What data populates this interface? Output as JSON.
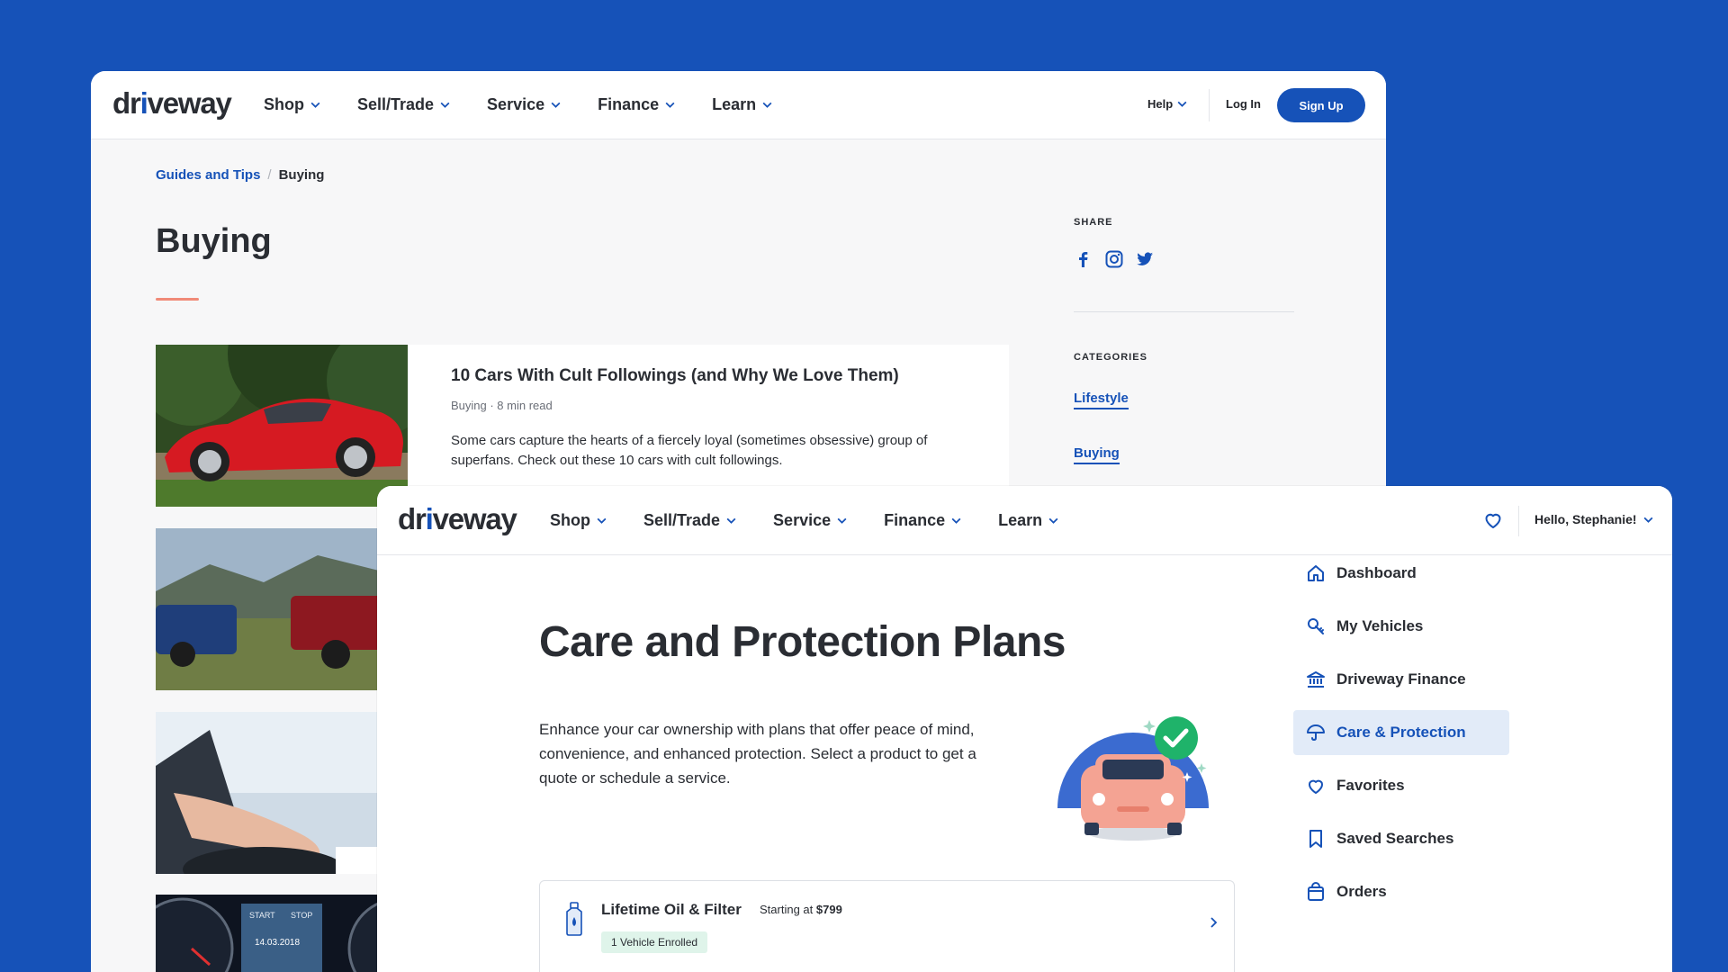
{
  "back": {
    "logo": {
      "pre": "dr",
      "i": "i",
      "post": "veway"
    },
    "nav": [
      "Shop",
      "Sell/Trade",
      "Service",
      "Finance",
      "Learn"
    ],
    "help": "Help",
    "login": "Log In",
    "signup": "Sign Up",
    "breadcrumb": {
      "parent": "Guides and Tips",
      "separator": "/",
      "current": "Buying"
    },
    "title": "Buying",
    "article": {
      "title": "10 Cars With Cult Followings (and Why We Love Them)",
      "meta": "Buying · 8 min read",
      "desc": "Some cars capture the hearts of a fiercely loyal (sometimes obsessive) group of superfans. Check out these 10 cars with cult followings."
    },
    "dash_text": {
      "start": "START",
      "stop": "STOP",
      "date": "14.03.2018"
    },
    "share_label": "SHARE",
    "share_icons": [
      "facebook-icon",
      "instagram-icon",
      "twitter-icon"
    ],
    "categories_label": "CATEGORIES",
    "categories": [
      "Lifestyle",
      "Buying"
    ]
  },
  "front": {
    "logo": {
      "pre": "dr",
      "i": "i",
      "post": "veway"
    },
    "nav": [
      "Shop",
      "Sell/Trade",
      "Service",
      "Finance",
      "Learn"
    ],
    "greeting": "Hello, Stephanie!",
    "title": "Care and Protection Plans",
    "desc": "Enhance your car ownership with plans that offer peace of mind, convenience, and enhanced protection. Select a product to get a quote or schedule a service.",
    "product": {
      "name": "Lifetime Oil & Filter",
      "price_prefix": "Starting at",
      "price": "$799",
      "badge": "1 Vehicle Enrolled"
    },
    "sidebar": [
      {
        "label": "Dashboard",
        "icon": "home-icon"
      },
      {
        "label": "My Vehicles",
        "icon": "car-key-icon"
      },
      {
        "label": "Driveway Finance",
        "icon": "bank-icon"
      },
      {
        "label": "Care & Protection",
        "icon": "umbrella-icon",
        "active": true
      },
      {
        "label": "Favorites",
        "icon": "heart-icon"
      },
      {
        "label": "Saved Searches",
        "icon": "bookmark-icon"
      },
      {
        "label": "Orders",
        "icon": "bag-icon"
      }
    ]
  },
  "colors": {
    "background": "#1652b8",
    "brand": "#1652b8",
    "accent_line": "#f08a78",
    "badge": "#dff4ea",
    "active_nav": "#e2ebf8"
  }
}
